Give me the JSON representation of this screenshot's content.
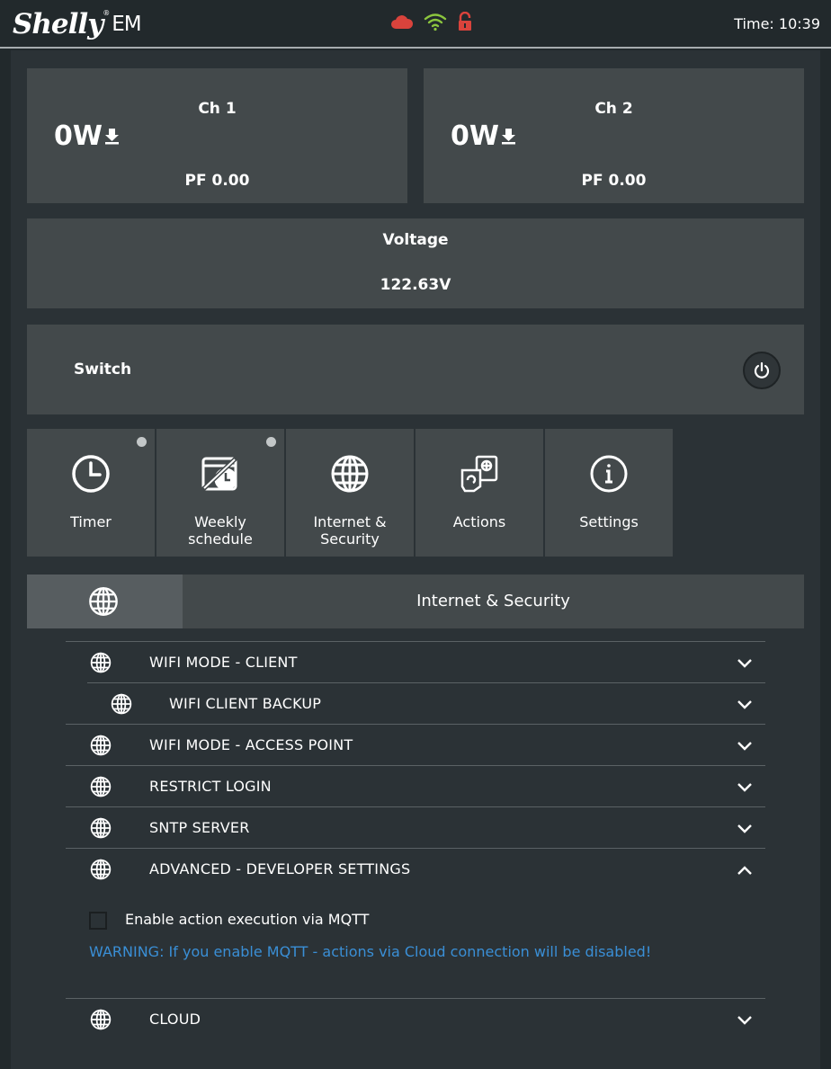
{
  "header": {
    "logo_script": "Shelly",
    "logo_reg": "®",
    "logo_model": "EM",
    "time": "Time: 10:39",
    "icons": [
      "cloud-icon",
      "wifi-icon",
      "lock-open-icon"
    ],
    "colors": {
      "cloud": "#d9433c",
      "wifi": "#8cc63e",
      "lock": "#d9433c"
    }
  },
  "channels": [
    {
      "title": "Ch 1",
      "power": "0W",
      "pf": "PF 0.00"
    },
    {
      "title": "Ch 2",
      "power": "0W",
      "pf": "PF 0.00"
    }
  ],
  "voltage": {
    "title": "Voltage",
    "value": "122.63V"
  },
  "switch": {
    "label": "Switch"
  },
  "tiles": [
    {
      "label": "Timer",
      "icon": "clock-icon",
      "dot": true
    },
    {
      "label": "Weekly\nschedule",
      "icon": "weekly-schedule-icon",
      "dot": true
    },
    {
      "label": "Internet &\nSecurity",
      "icon": "globe-icon",
      "dot": false
    },
    {
      "label": "Actions",
      "icon": "actions-icon",
      "dot": false
    },
    {
      "label": "Settings",
      "icon": "info-icon",
      "dot": false
    }
  ],
  "section": {
    "title": "Internet & Security",
    "icon": "globe-icon"
  },
  "rows": [
    {
      "label": "WIFI MODE - CLIENT",
      "expanded": false
    },
    {
      "label": "WIFI CLIENT BACKUP",
      "expanded": false
    },
    {
      "label": "WIFI MODE - ACCESS POINT",
      "expanded": false
    },
    {
      "label": "RESTRICT LOGIN",
      "expanded": false
    },
    {
      "label": "SNTP SERVER",
      "expanded": false
    },
    {
      "label": "ADVANCED - DEVELOPER SETTINGS",
      "expanded": true
    },
    {
      "label": "CLOUD",
      "expanded": false
    }
  ],
  "advanced": {
    "mqtt_label": "Enable action execution via MQTT",
    "mqtt_checked": false,
    "warning": "WARNING: If you enable MQTT - actions via Cloud connection will be disabled!",
    "warning_color": "#3a8fd6"
  }
}
